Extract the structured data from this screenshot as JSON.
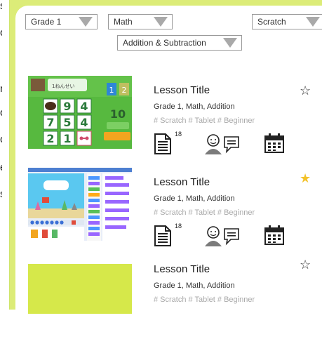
{
  "left_panel": {
    "fragments": [
      "s",
      "o",
      "n",
      "or",
      "oj",
      "e",
      "st"
    ]
  },
  "filters": {
    "grade": "Grade 1",
    "subject": "Math",
    "tool": "Scratch",
    "topic": "Addition & Subtraction"
  },
  "lessons": [
    {
      "title": "Lesson Title",
      "meta": "Grade 1, Math, Addition",
      "tags": "# Scratch # Tablet # Beginner",
      "doc_count": "18",
      "favorited": false,
      "thumb_caption": "1ねんせい",
      "thumb_numbers": [
        "9",
        "4",
        "7",
        "5",
        "4",
        "2",
        "1"
      ]
    },
    {
      "title": "Lesson Title",
      "meta": "Grade 1, Math, Addition",
      "tags": "# Scratch # Tablet # Beginner",
      "doc_count": "18",
      "favorited": true
    },
    {
      "title": "Lesson Title",
      "meta": "Grade 1, Math, Addition",
      "tags": "# Scratch # Tablet # Beginner",
      "favorited": false
    }
  ],
  "icons": {
    "star_empty": "star-outline-icon",
    "star_filled": "star-filled-icon",
    "document": "document-icon",
    "discussion": "discussion-icon",
    "calendar": "calendar-icon"
  },
  "colors": {
    "frame_green": "#dcec78",
    "thumb_yellow_green": "#d6e84a",
    "star_gold": "#f3c22a"
  }
}
